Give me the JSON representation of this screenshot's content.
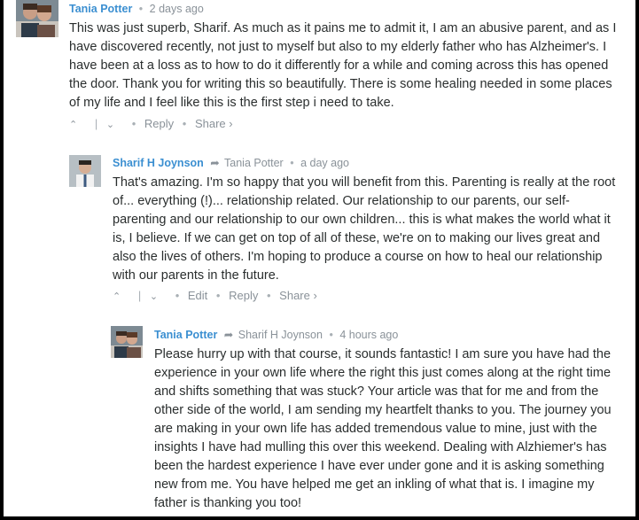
{
  "comments": [
    {
      "author": "Tania Potter",
      "reply_to": "",
      "time": "2 days ago",
      "text": "This was just superb, Sharif. As much as it pains me to admit it, I am an abusive parent, and as I have discovered recently, not just to myself but also to my elderly father who has Alzheimer's. I have been at a loss as to how to do it differently for a while and coming across this has opened the door. Thank you for writing this so beautifully. There is some healing needed in some places of my life and I feel like this is the first step i need to take.",
      "actions": {
        "reply": "Reply",
        "share": "Share ›"
      }
    },
    {
      "author": "Sharif H Joynson",
      "reply_to": "Tania Potter",
      "time": "a day ago",
      "text": "That's amazing. I'm so happy that you will benefit from this. Parenting is really at the root of... everything (!)... relationship related. Our relationship to our parents, our self-parenting and our relationship to our own children... this is what makes the world what it is, I believe. If we can get on top of all of these, we're on to making our lives great and also the lives of others. I'm hoping to produce a course on how to heal our relationship with our parents in the future.",
      "actions": {
        "edit": "Edit",
        "reply": "Reply",
        "share": "Share ›"
      }
    },
    {
      "author": "Tania Potter",
      "reply_to": "Sharif H Joynson",
      "time": "4 hours ago",
      "text": "Please hurry up with that course, it sounds fantastic! I am sure you have had the experience in your own life where the right this just comes along at the right time and shifts something that was stuck? Your article was that for me and from the other side of the world, I am sending my heartfelt thanks to you. The journey you are making in your own life has added tremendous value to mine, just with the insights I have had mulling this over this weekend. Dealing with Alzhiemer's has been the hardest experience I have ever under gone and it is asking something new from me. You have helped me get an inkling of what that is. I imagine my father is thanking you too!"
    }
  ],
  "icons": {
    "upvote": "chevron-up-icon",
    "downvote": "chevron-down-icon",
    "reply_arrow": "reply-arrow-icon"
  }
}
